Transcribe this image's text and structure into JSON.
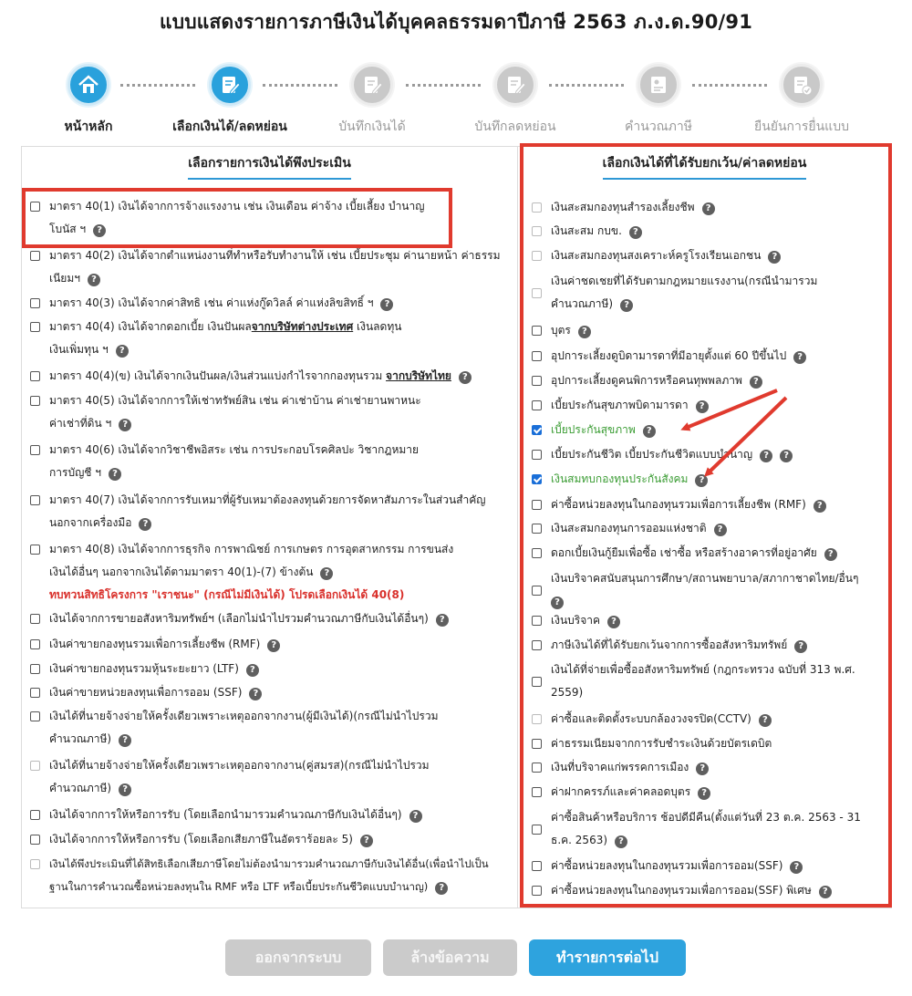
{
  "title": "แบบแสดงรายการภาษีเงินได้บุคคลธรรมดาปีภาษี 2563 ภ.ง.ด.90/91",
  "steps": [
    {
      "label": "หน้าหลัก",
      "icon": "home-icon",
      "state": "active"
    },
    {
      "label": "เลือกเงินได้/ลดหย่อน",
      "icon": "edit-document-icon",
      "state": "active"
    },
    {
      "label": "บันทึกเงินได้",
      "icon": "document-edit-icon",
      "state": "inactive"
    },
    {
      "label": "บันทึกลดหย่อน",
      "icon": "document-edit-icon",
      "state": "inactive"
    },
    {
      "label": "คำนวณภาษี",
      "icon": "calculator-document-icon",
      "state": "inactive"
    },
    {
      "label": "ยืนยันการยื่นแบบ",
      "icon": "document-check-icon",
      "state": "inactive"
    }
  ],
  "left_panel": {
    "title": "เลือกรายการเงินได้พึงประเมิน",
    "items": [
      {
        "lines": [
          "มาตรา 40(1) เงินได้จากการจ้างแรงงาน เช่น เงินเดือน ค่าจ้าง เบี้ยเลี้ยง บำนาญ",
          "โบนัส ฯ"
        ]
      },
      {
        "lines": [
          "มาตรา 40(2) เงินได้จากตำแหน่งงานที่ทำหรือรับทำงานให้ เช่น เบี้ยประชุม ค่านายหน้า ค่าธรรม",
          "เนียมฯ"
        ]
      },
      {
        "lines": [
          "มาตรา 40(3) เงินได้จากค่าสิทธิ เช่น ค่าแห่งกู๊ดวิลล์ ค่าแห่งลิขสิทธิ์ ฯ"
        ]
      },
      {
        "pre": "มาตรา 40(4) เงินได้จากดอกเบี้ย เงินปันผล",
        "bold": "จากบริษัทต่างประเทศ",
        "post": " เงินลดทุน",
        "line2": "เงินเพิ่มทุน ฯ"
      },
      {
        "pre": "มาตรา 40(4)(ข) เงินได้จากเงินปันผล/เงินส่วนแบ่งกำไรจากกองทุนรวม ",
        "bold": "จากบริษัทไทย"
      },
      {
        "lines": [
          "มาตรา 40(5) เงินได้จากการให้เช่าทรัพย์สิน เช่น ค่าเช่าบ้าน ค่าเช่ายานพาหนะ",
          "ค่าเช่าที่ดิน ฯ"
        ]
      },
      {
        "lines": [
          "มาตรา 40(6) เงินได้จากวิชาชีพอิสระ เช่น การประกอบโรคศิลปะ วิชากฎหมาย",
          "การบัญชี ฯ"
        ]
      },
      {
        "lines": [
          "มาตรา 40(7) เงินได้จากการรับเหมาที่ผู้รับเหมาต้องลงทุนด้วยการจัดหาสัมภาระในส่วนสำคัญ",
          "นอกจากเครื่องมือ"
        ]
      },
      {
        "lines": [
          "มาตรา 40(8) เงินได้จากการธุรกิจ การพาณิชย์ การเกษตร การอุตสาหกรรม การขนส่ง",
          "เงินได้อื่นๆ นอกจากเงินได้ตามมาตรา 40(1)-(7) ข้างต้น"
        ],
        "note": "ทบทวนสิทธิโครงการ \"เราชนะ\" (กรณีไม่มีเงินได้) โปรดเลือกเงินได้ 40(8)"
      },
      {
        "lines": [
          "เงินได้จากการขายอสังหาริมทรัพย์ฯ (เลือกไม่นำไปรวมคำนวณภาษีกับเงินได้อื่นๆ)"
        ]
      },
      {
        "lines": [
          "เงินค่าขายกองทุนรวมเพื่อการเลี้ยงชีพ (RMF)"
        ]
      },
      {
        "lines": [
          "เงินค่าขายกองทุนรวมหุ้นระยะยาว (LTF)"
        ]
      },
      {
        "lines": [
          "เงินค่าขายหน่วยลงทุนเพื่อการออม (SSF)"
        ]
      },
      {
        "lines": [
          "เงินได้ที่นายจ้างจ่ายให้ครั้งเดียวเพราะเหตุออกจากงาน(ผู้มีเงินได้)(กรณีไม่นำไปรวม",
          "คำนวณภาษี)"
        ]
      },
      {
        "lines": [
          "เงินได้ที่นายจ้างจ่ายให้ครั้งเดียวเพราะเหตุออกจากงาน(คู่สมรส)(กรณีไม่นำไปรวม",
          "คำนวณภาษี)"
        ]
      },
      {
        "lines": [
          "เงินได้จากการให้หรือการรับ (โดยเลือกนำมารวมคำนวณภาษีกับเงินได้อื่นๆ)"
        ]
      },
      {
        "lines": [
          "เงินได้จากการให้หรือการรับ (โดยเลือกเสียภาษีในอัตราร้อยละ 5)"
        ]
      },
      {
        "lines": [
          "เงินได้พึงประเมินที่ได้สิทธิเลือกเสียภาษีโดยไม่ต้องนำมารวมคำนวณภาษีกับเงินได้อื่น(เพื่อนำไปเป็น",
          "ฐานในการคำนวณซื้อหน่วยลงทุนใน RMF หรือ LTF หรือเบี้ยประกันชีวิตแบบบำนาญ)"
        ]
      }
    ]
  },
  "right_panel": {
    "title": "เลือกเงินได้ที่ได้รับยกเว้น/ค่าลดหย่อน",
    "items": [
      {
        "lines": [
          "เงินสะสมกองทุนสำรองเลี้ยงชีพ"
        ],
        "state": "disabled"
      },
      {
        "lines": [
          "เงินสะสม กบข."
        ],
        "state": "disabled"
      },
      {
        "lines": [
          "เงินสะสมกองทุนสงเคราะห์ครูโรงเรียนเอกชน"
        ],
        "state": "disabled"
      },
      {
        "lines": [
          "เงินค่าชดเชยที่ได้รับตามกฎหมายแรงงาน(กรณีนำมารวม",
          "คำนวณภาษี)"
        ],
        "state": "disabled"
      },
      {
        "lines": [
          "บุตร"
        ],
        "state": "unchecked"
      },
      {
        "lines": [
          "อุปการะเลี้ยงดูบิดามารดาที่มีอายุตั้งแต่ 60 ปีขึ้นไป"
        ],
        "state": "unchecked"
      },
      {
        "lines": [
          "อุปการะเลี้ยงดูคนพิการหรือคนทุพพลภาพ"
        ],
        "state": "unchecked"
      },
      {
        "lines": [
          "เบี้ยประกันสุขภาพบิดามารดา"
        ],
        "state": "unchecked"
      },
      {
        "lines": [
          "เบี้ยประกันสุขภาพ"
        ],
        "state": "checked"
      },
      {
        "lines": [
          "เบี้ยประกันชีวิต เบี้ยประกันชีวิตแบบบำนาญ"
        ],
        "state": "unchecked",
        "extra_help": true
      },
      {
        "lines": [
          "เงินสมทบกองทุนประกันสังคม"
        ],
        "state": "checked"
      },
      {
        "lines": [
          "ค่าซื้อหน่วยลงทุนในกองทุนรวมเพื่อการเลี้ยงชีพ (RMF)"
        ],
        "state": "unchecked"
      },
      {
        "lines": [
          "เงินสะสมกองทุนการออมแห่งชาติ"
        ],
        "state": "unchecked"
      },
      {
        "lines": [
          "ดอกเบี้ยเงินกู้ยืมเพื่อซื้อ เช่าซื้อ หรือสร้างอาคารที่อยู่อาศัย"
        ],
        "state": "unchecked"
      },
      {
        "lines": [
          "เงินบริจาคสนับสนุนการศึกษา/สถานพยาบาล/สภากาชาดไทย/อื่นๆ",
          ""
        ],
        "state": "unchecked"
      },
      {
        "lines": [
          "เงินบริจาค"
        ],
        "state": "unchecked"
      },
      {
        "lines": [
          "ภาษีเงินได้ที่ได้รับยกเว้นจากการซื้ออสังหาริมทรัพย์"
        ],
        "state": "unchecked"
      },
      {
        "lines": [
          "เงินได้ที่จ่ายเพื่อซื้ออสังหาริมทรัพย์ (กฎกระทรวง ฉบับที่ 313 พ.ศ.",
          "2559)"
        ],
        "state": "unchecked"
      },
      {
        "lines": [
          "ค่าซื้อและติดตั้งระบบกล้องวงจรปิด(CCTV)"
        ],
        "state": "unchecked"
      },
      {
        "lines": [
          "ค่าธรรมเนียมจากการรับชำระเงินด้วยบัตรเดบิต"
        ],
        "state": "unchecked"
      },
      {
        "lines": [
          "เงินที่บริจาคแก่พรรคการเมือง"
        ],
        "state": "unchecked"
      },
      {
        "lines": [
          "ค่าฝากครรภ์และค่าคลอดบุตร"
        ],
        "state": "unchecked"
      },
      {
        "lines": [
          "ค่าซื้อสินค้าหรือบริการ ช้อปดีมีคืน(ตั้งแต่วันที่ 23 ต.ค. 2563 - 31",
          "ธ.ค. 2563)"
        ],
        "state": "unchecked"
      },
      {
        "lines": [
          "ค่าซื้อหน่วยลงทุนในกองทุนรวมเพื่อการออม(SSF)"
        ],
        "state": "unchecked"
      },
      {
        "lines": [
          "ค่าซื้อหน่วยลงทุนในกองทุนรวมเพื่อการออม(SSF) พิเศษ"
        ],
        "state": "unchecked"
      }
    ]
  },
  "buttons": {
    "logout": "ออกจากระบบ",
    "clear": "ล้างข้อความ",
    "next": "ทำรายการต่อไป"
  },
  "help_glyph": "?",
  "colors": {
    "accent": "#2ea3de",
    "highlight_border": "#e03a2e",
    "checked_text": "#3a9c33",
    "note_red": "#d9302b"
  }
}
